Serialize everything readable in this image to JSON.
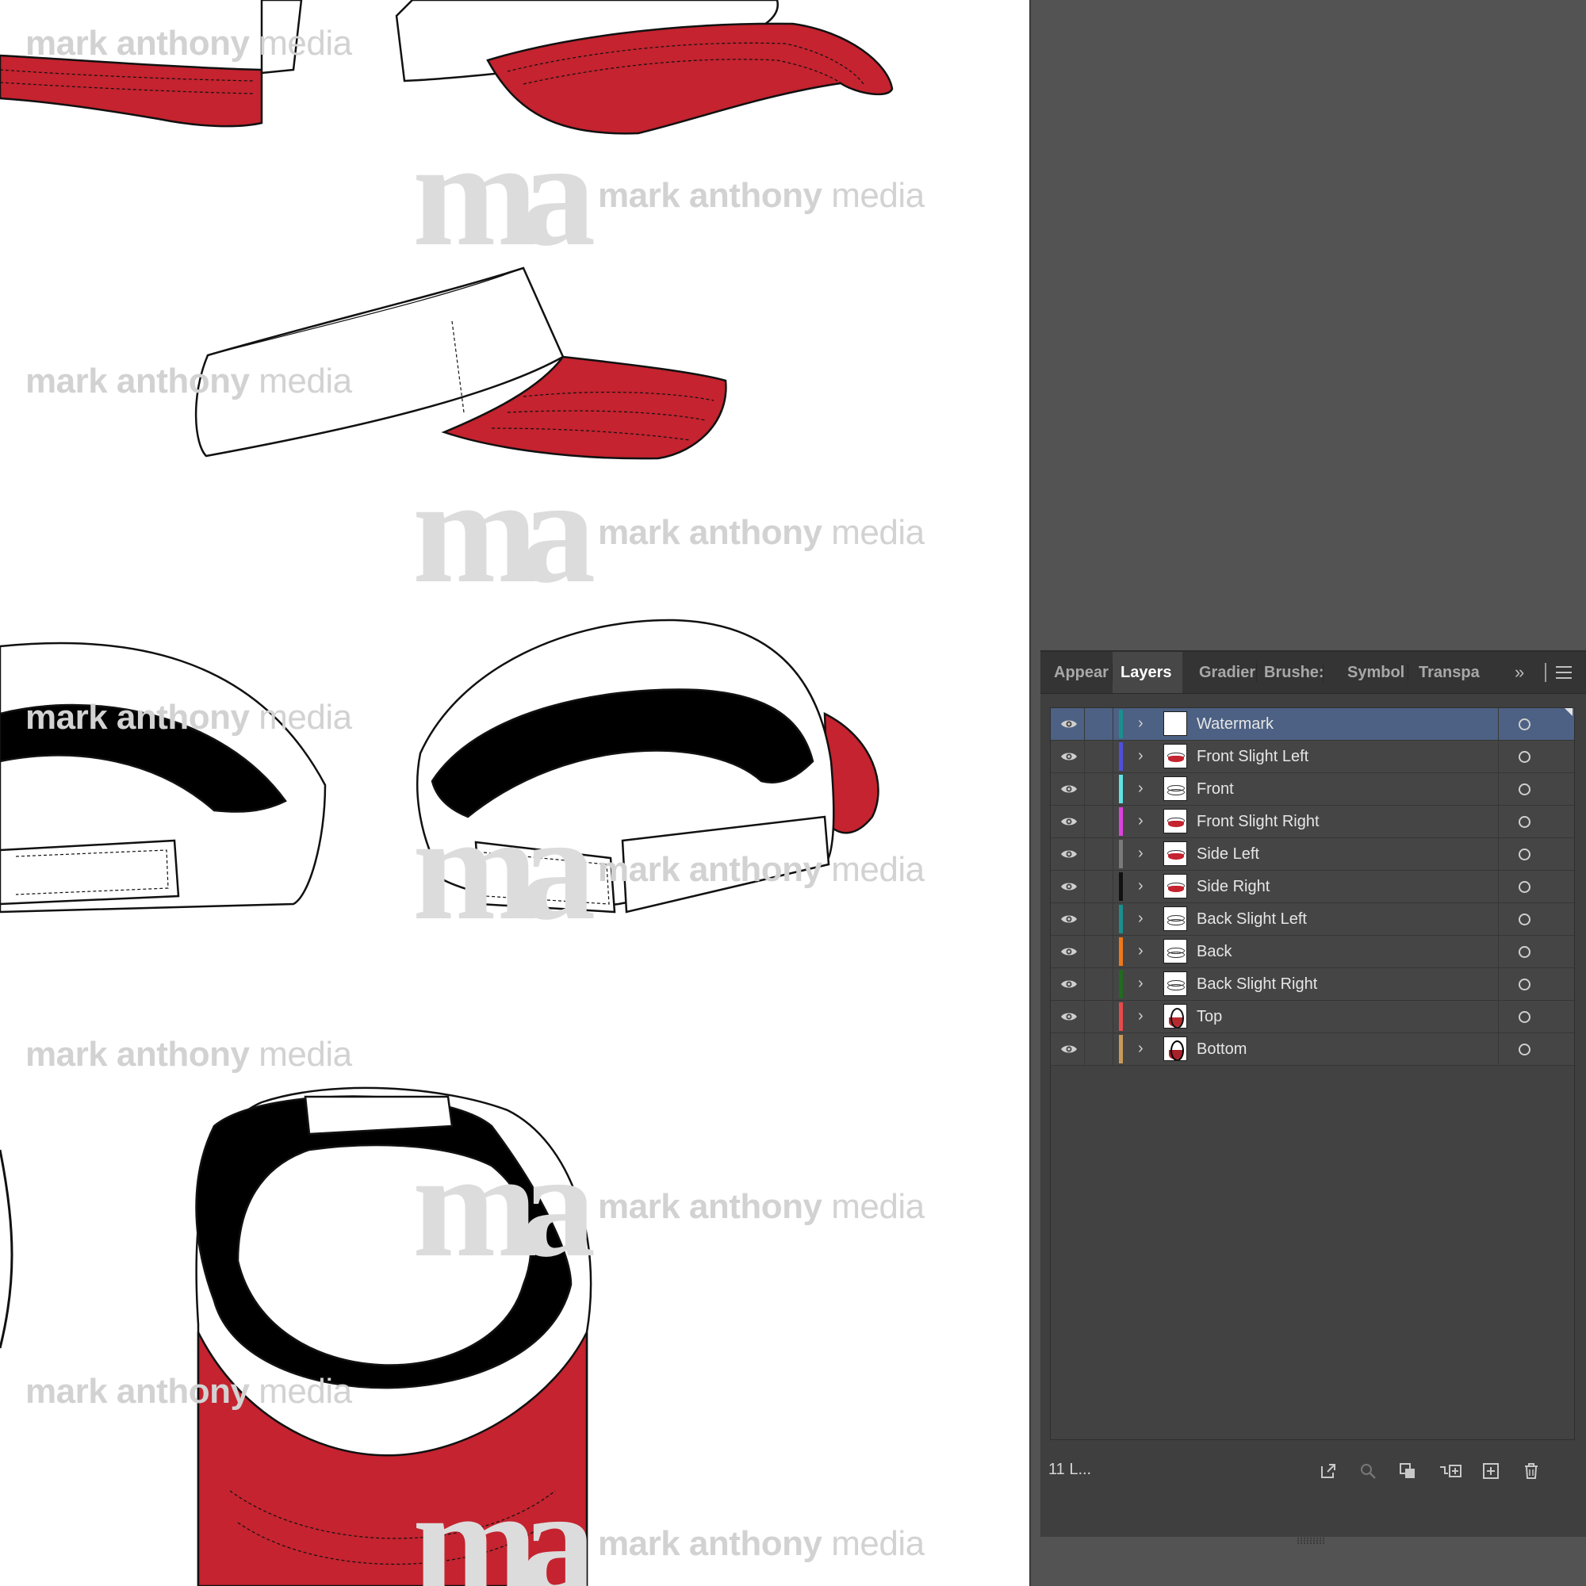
{
  "canvas": {
    "watermark": {
      "bold": "mark anthony",
      "light": "media"
    }
  },
  "panel": {
    "tabs": [
      {
        "label": "Appear",
        "active": false
      },
      {
        "label": "Layers",
        "active": true
      },
      {
        "label": "Gradier",
        "active": false
      },
      {
        "label": "Brushe:",
        "active": false
      },
      {
        "label": "Symbol",
        "active": false
      },
      {
        "label": "Transpa",
        "active": false
      }
    ],
    "overflow_glyph": "»",
    "layers": [
      {
        "name": "Watermark",
        "color": "#1a8f8f",
        "selected": true,
        "thumb": "blank"
      },
      {
        "name": "Front Slight Left",
        "color": "#4f4fe0",
        "selected": false,
        "thumb": "red"
      },
      {
        "name": "Front",
        "color": "#5fe3e3",
        "selected": false,
        "thumb": "line"
      },
      {
        "name": "Front Slight Right",
        "color": "#e040e0",
        "selected": false,
        "thumb": "red"
      },
      {
        "name": "Side Left",
        "color": "#7a7a7a",
        "selected": false,
        "thumb": "red"
      },
      {
        "name": "Side Right",
        "color": "#111111",
        "selected": false,
        "thumb": "red"
      },
      {
        "name": "Back Slight Left",
        "color": "#1a8f8f",
        "selected": false,
        "thumb": "line"
      },
      {
        "name": "Back",
        "color": "#f07818",
        "selected": false,
        "thumb": "line"
      },
      {
        "name": "Back Slight Right",
        "color": "#1f6b1f",
        "selected": false,
        "thumb": "line"
      },
      {
        "name": "Top",
        "color": "#e84a4a",
        "selected": false,
        "thumb": "oval"
      },
      {
        "name": "Bottom",
        "color": "#c89a5a",
        "selected": false,
        "thumb": "bottom"
      }
    ],
    "footer": {
      "layer_count": "11 L..."
    }
  }
}
